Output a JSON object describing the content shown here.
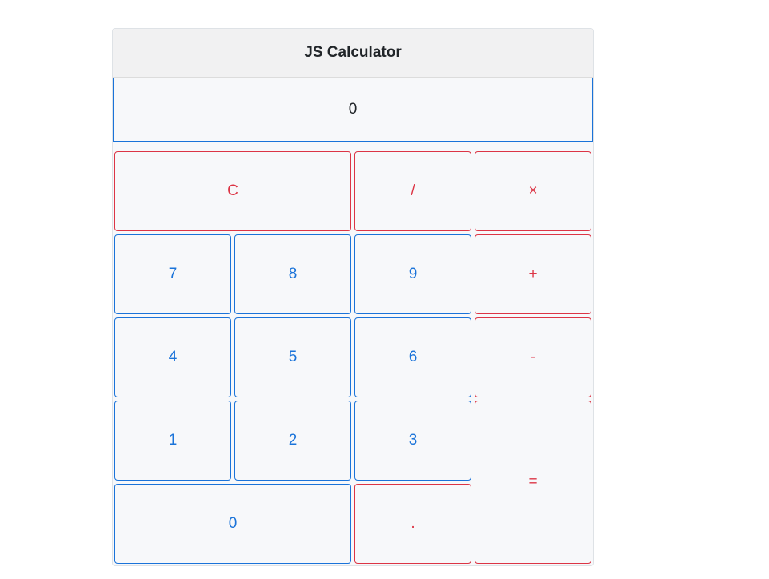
{
  "calculator": {
    "title": "JS Calculator",
    "display_value": "0",
    "keys": {
      "clear": "C",
      "divide": "/",
      "multiply": "×",
      "seven": "7",
      "eight": "8",
      "nine": "9",
      "add": "+",
      "four": "4",
      "five": "5",
      "six": "6",
      "subtract": "-",
      "one": "1",
      "two": "2",
      "three": "3",
      "equals": "=",
      "zero": "0",
      "decimal": "."
    }
  },
  "colors": {
    "number_key": "#1a73d9",
    "operator_key": "#dc3545",
    "key_background": "#f7f8fa",
    "header_background": "#f1f1f2"
  }
}
